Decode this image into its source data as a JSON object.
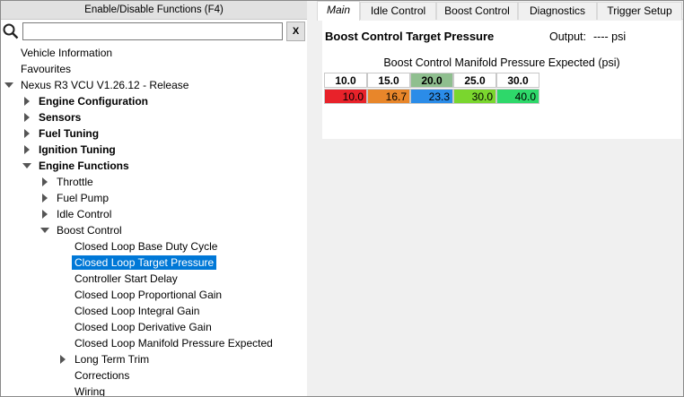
{
  "left": {
    "enable_button": "Enable/Disable Functions (F4)",
    "search": {
      "value": "",
      "placeholder": ""
    },
    "clear_label": "X",
    "tree": [
      {
        "label": "Vehicle Information",
        "depth": 0,
        "expander": "none",
        "bold": false,
        "selected": false
      },
      {
        "label": "Favourites",
        "depth": 0,
        "expander": "none",
        "bold": false,
        "selected": false
      },
      {
        "label": "Nexus R3 VCU V1.26.12 - Release",
        "depth": 0,
        "expander": "expanded",
        "bold": false,
        "selected": false
      },
      {
        "label": "Engine Configuration",
        "depth": 1,
        "expander": "collapsed",
        "bold": true,
        "selected": false
      },
      {
        "label": "Sensors",
        "depth": 1,
        "expander": "collapsed",
        "bold": true,
        "selected": false
      },
      {
        "label": "Fuel Tuning",
        "depth": 1,
        "expander": "collapsed",
        "bold": true,
        "selected": false
      },
      {
        "label": "Ignition Tuning",
        "depth": 1,
        "expander": "collapsed",
        "bold": true,
        "selected": false
      },
      {
        "label": "Engine Functions",
        "depth": 1,
        "expander": "expanded",
        "bold": true,
        "selected": false
      },
      {
        "label": "Throttle",
        "depth": 2,
        "expander": "collapsed",
        "bold": false,
        "selected": false
      },
      {
        "label": "Fuel Pump",
        "depth": 2,
        "expander": "collapsed",
        "bold": false,
        "selected": false
      },
      {
        "label": "Idle Control",
        "depth": 2,
        "expander": "collapsed",
        "bold": false,
        "selected": false
      },
      {
        "label": "Boost Control",
        "depth": 2,
        "expander": "expanded",
        "bold": false,
        "selected": false
      },
      {
        "label": "Closed Loop Base Duty Cycle",
        "depth": 3,
        "expander": "none",
        "bold": false,
        "selected": false
      },
      {
        "label": "Closed Loop Target Pressure",
        "depth": 3,
        "expander": "none",
        "bold": false,
        "selected": true
      },
      {
        "label": "Controller Start Delay",
        "depth": 3,
        "expander": "none",
        "bold": false,
        "selected": false
      },
      {
        "label": "Closed Loop Proportional Gain",
        "depth": 3,
        "expander": "none",
        "bold": false,
        "selected": false
      },
      {
        "label": "Closed Loop Integral Gain",
        "depth": 3,
        "expander": "none",
        "bold": false,
        "selected": false
      },
      {
        "label": "Closed Loop Derivative Gain",
        "depth": 3,
        "expander": "none",
        "bold": false,
        "selected": false
      },
      {
        "label": "Closed Loop Manifold Pressure Expected",
        "depth": 3,
        "expander": "none",
        "bold": false,
        "selected": false
      },
      {
        "label": "Long Term Trim",
        "depth": 3,
        "expander": "collapsed",
        "bold": false,
        "selected": false
      },
      {
        "label": "Corrections",
        "depth": 3,
        "expander": "none",
        "bold": false,
        "selected": false
      },
      {
        "label": "Wiring",
        "depth": 3,
        "expander": "none",
        "bold": false,
        "selected": false
      }
    ]
  },
  "right": {
    "tabs": [
      {
        "label": "Main",
        "active": true
      },
      {
        "label": "Idle Control",
        "active": false
      },
      {
        "label": "Boost Control",
        "active": false
      },
      {
        "label": "Diagnostics",
        "active": false
      },
      {
        "label": "Trigger Setup",
        "active": false
      }
    ],
    "title": "Boost Control Target Pressure",
    "output_label": "Output:",
    "output_value": "---- psi",
    "table_title": "Boost Control Manifold Pressure Expected (psi)",
    "table": {
      "headers": [
        "10.0",
        "15.0",
        "20.0",
        "25.0",
        "30.0"
      ],
      "highlighted_header": 2,
      "values": [
        "10.0",
        "16.7",
        "23.3",
        "30.0",
        "40.0"
      ],
      "value_colors": [
        "#e8222a",
        "#e8862a",
        "#2b8ce8",
        "#7ad62e",
        "#2ed86a"
      ]
    }
  }
}
